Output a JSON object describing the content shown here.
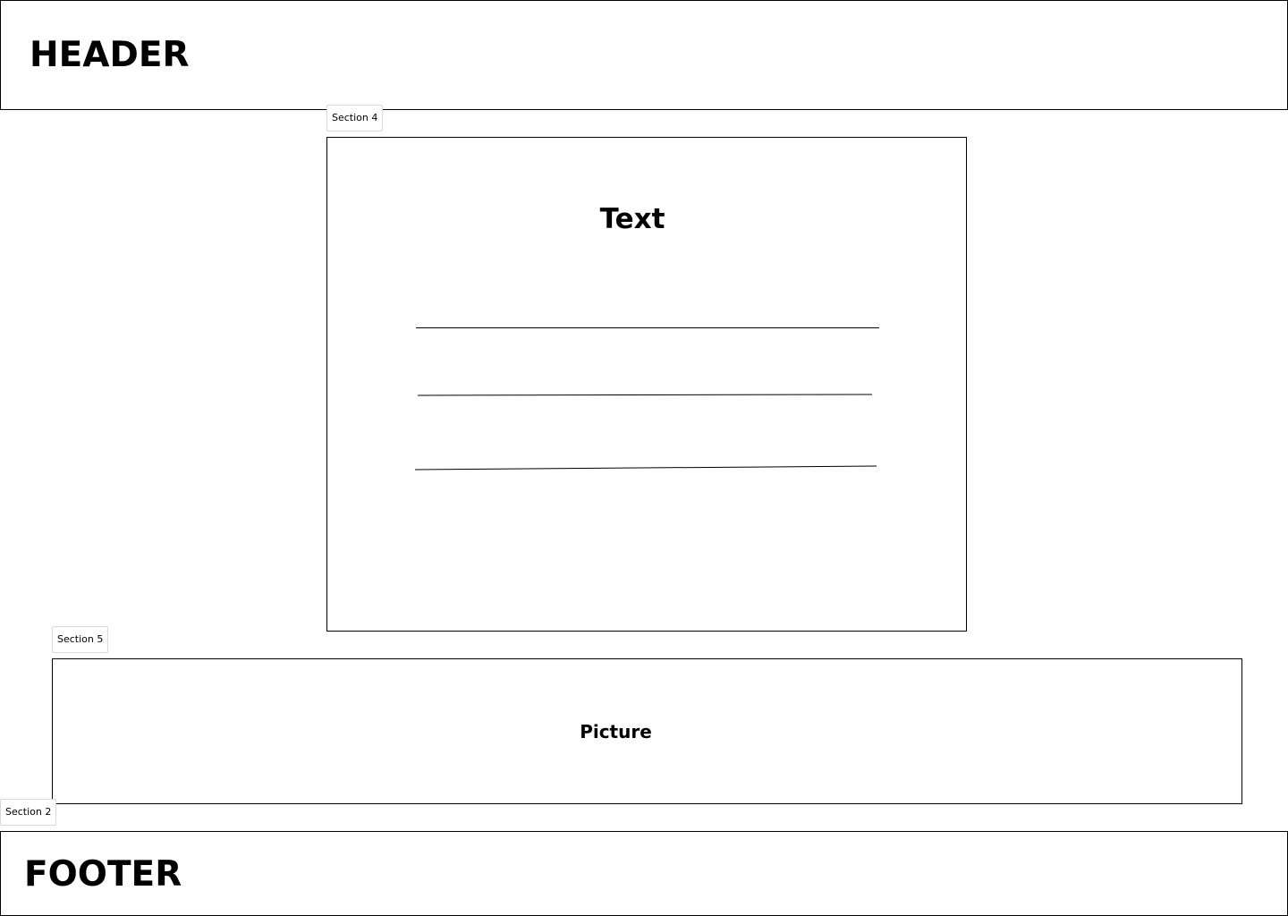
{
  "header": {
    "title": "HEADER"
  },
  "section_tags": {
    "content": "Section 4",
    "picture": "Section 5",
    "footer": "Section 2"
  },
  "content": {
    "title": "Text"
  },
  "picture": {
    "label": "Picture"
  },
  "footer": {
    "title": "FOOTER"
  }
}
